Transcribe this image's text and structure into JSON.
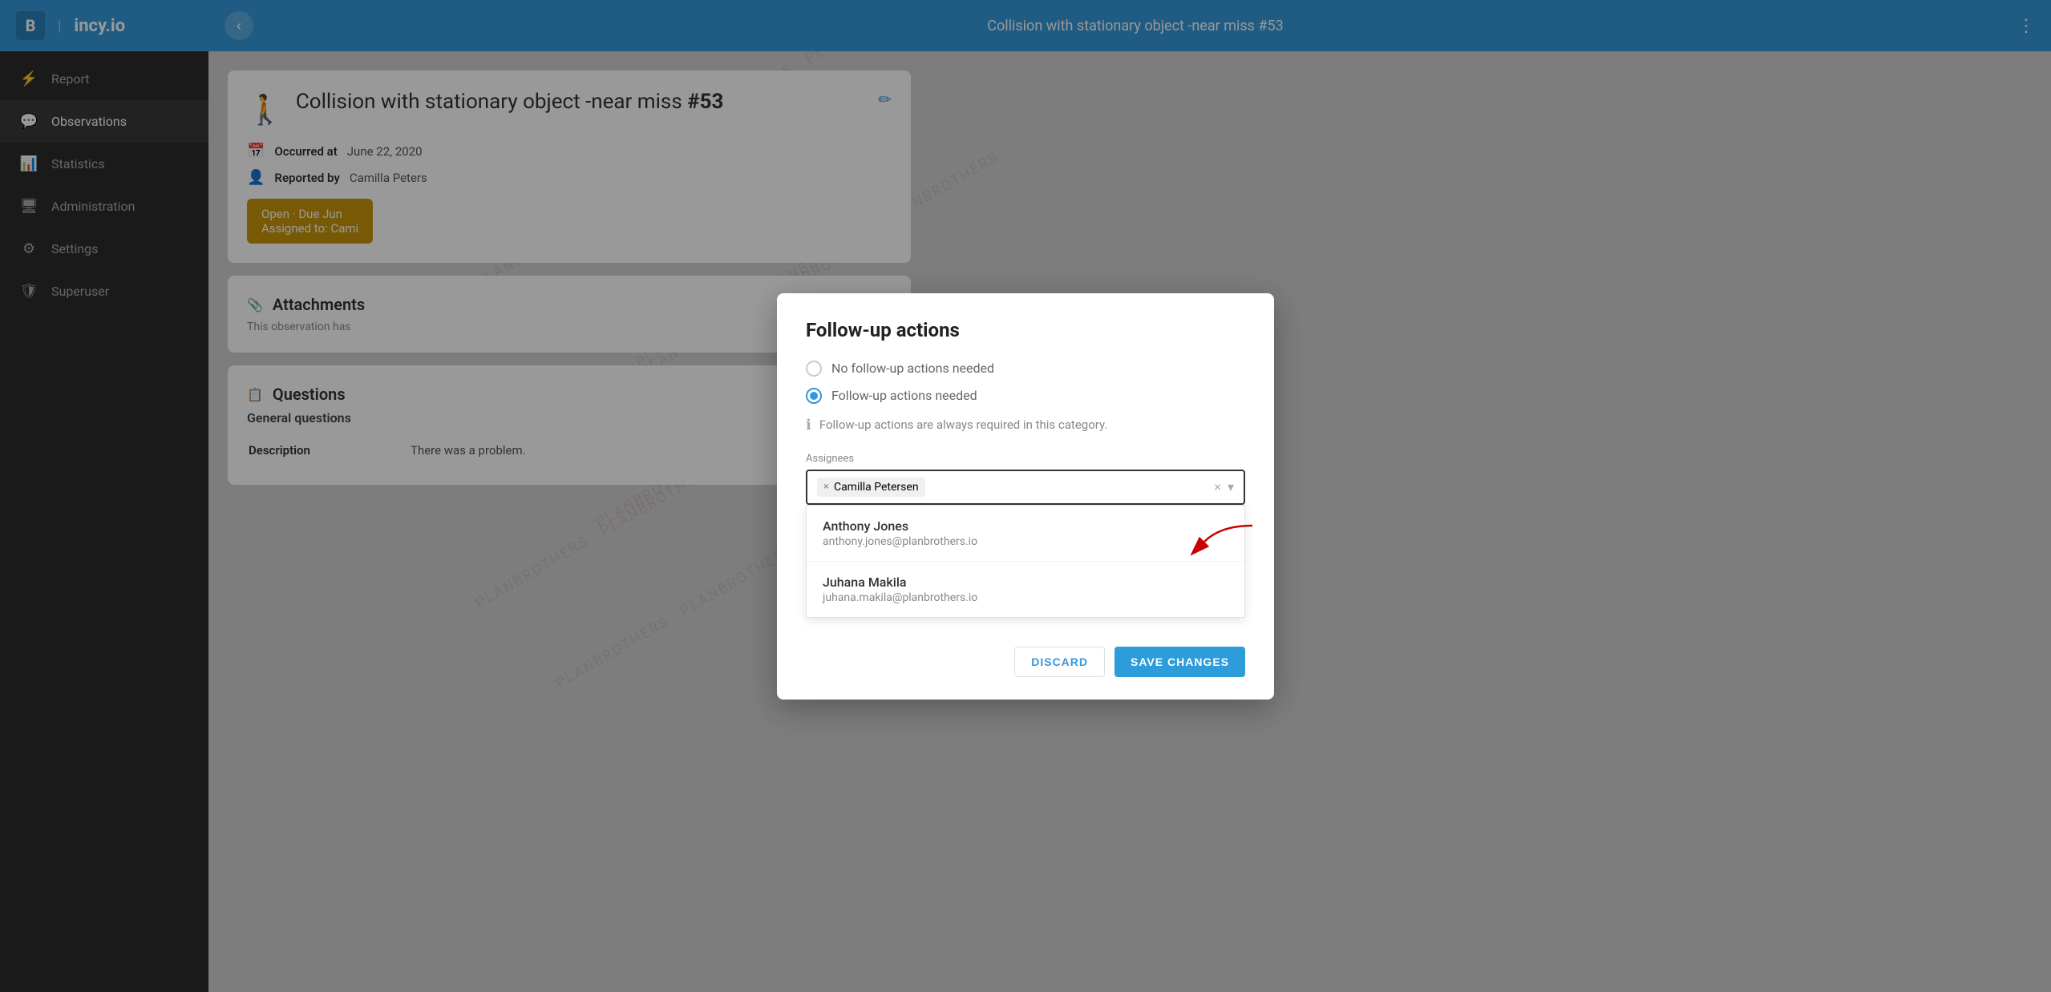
{
  "sidebar": {
    "logo": "B",
    "brand": "incy.io",
    "divider": "|",
    "items": [
      {
        "id": "report",
        "label": "Report",
        "icon": "⚡"
      },
      {
        "id": "observations",
        "label": "Observations",
        "icon": "💬",
        "active": true
      },
      {
        "id": "statistics",
        "label": "Statistics",
        "icon": "📊"
      },
      {
        "id": "administration",
        "label": "Administration",
        "icon": "🖥"
      },
      {
        "id": "settings",
        "label": "Settings",
        "icon": "⚙"
      },
      {
        "id": "superuser",
        "label": "Superuser",
        "icon": "🛡"
      }
    ]
  },
  "topbar": {
    "title": "Collision with stationary object -near miss #53",
    "back_icon": "‹",
    "more_icon": "⋮"
  },
  "observation": {
    "title": "Collision with stationary object -near miss ",
    "number": "#53",
    "occurred_label": "Occurred at",
    "occurred_value": "June 22, 2020",
    "reported_label": "Reported by",
    "reported_value": "Camilla Peters",
    "status_text": "Open · Due Jun",
    "assigned_label": "Assigned to: Cami"
  },
  "sections": {
    "attachments_title": "Attachments",
    "attachments_note": "This observation has",
    "questions_title": "Questions",
    "questions_edit_icon": "✏",
    "general_questions": "General questions",
    "description_label": "Description",
    "description_value": "There was a problem."
  },
  "modal": {
    "title": "Follow-up actions",
    "option1": "No follow-up actions needed",
    "option2": "Follow-up actions needed",
    "info_note": "Follow-up actions are always required in this category.",
    "assignees_label": "Assignees",
    "selected_assignee": "Camilla Petersen",
    "dropdown_items": [
      {
        "name": "Anthony Jones",
        "email": "anthony.jones@planbrothers.io"
      },
      {
        "name": "Juhana Makila",
        "email": "juhana.makila@planbrothers.io"
      }
    ],
    "discard_label": "DISCARD",
    "save_label": "SAVE CHANGES",
    "selected_radio": "option2"
  },
  "colors": {
    "primary_blue": "#3498db",
    "sidebar_bg": "#2c2c2c",
    "status_gold": "#c8960a"
  }
}
